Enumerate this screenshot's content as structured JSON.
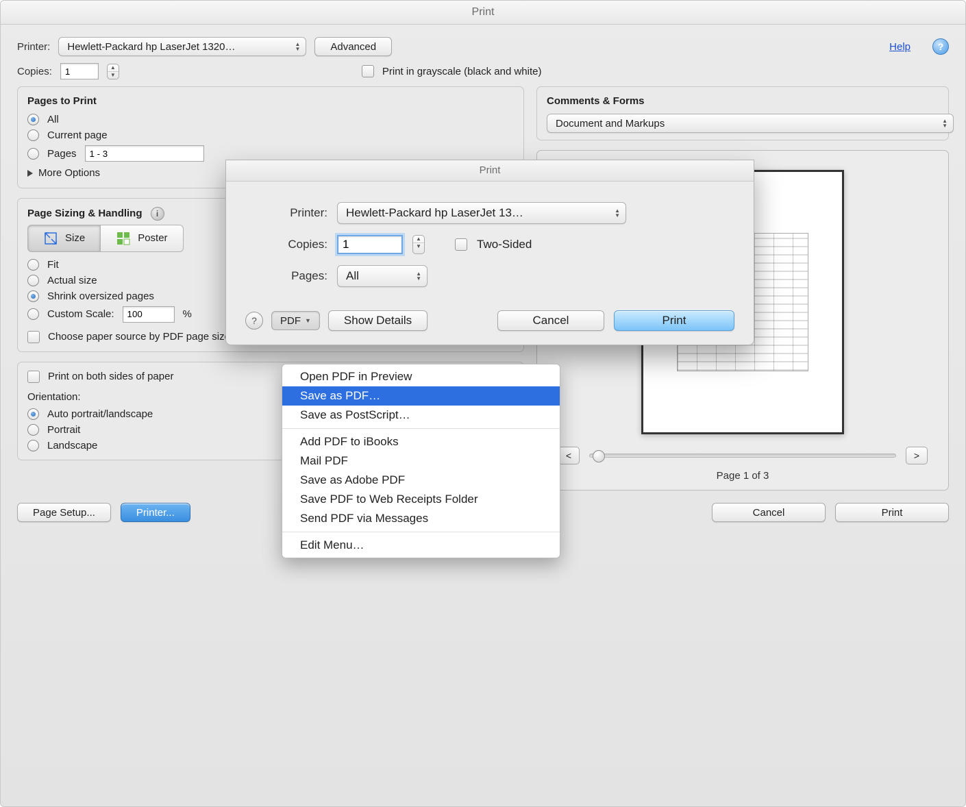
{
  "window": {
    "title": "Print"
  },
  "header": {
    "printer_label": "Printer:",
    "printer_value": "Hewlett-Packard hp LaserJet 1320…",
    "advanced": "Advanced",
    "help": "Help",
    "copies_label": "Copies:",
    "copies_value": "1",
    "grayscale_label": "Print in grayscale (black and white)"
  },
  "pages": {
    "title": "Pages to Print",
    "all": "All",
    "current": "Current page",
    "pages_label": "Pages",
    "pages_value": "1 - 3",
    "more": "More Options"
  },
  "sizing": {
    "title": "Page Sizing & Handling",
    "size_btn": "Size",
    "poster_btn": "Poster",
    "fit": "Fit",
    "actual": "Actual size",
    "shrink": "Shrink oversized pages",
    "custom": "Custom Scale:",
    "custom_value": "100",
    "custom_unit": "%",
    "paper_source": "Choose paper source by PDF page size"
  },
  "orientation": {
    "duplex": "Print on both sides of paper",
    "title": "Orientation:",
    "auto": "Auto portrait/landscape",
    "portrait": "Portrait",
    "landscape": "Landscape"
  },
  "comments": {
    "title": "Comments & Forms",
    "value": "Document and Markups"
  },
  "preview": {
    "prev": "<",
    "next": ">",
    "page_of": "Page 1 of 3"
  },
  "footer": {
    "page_setup": "Page Setup...",
    "printer": "Printer...",
    "cancel": "Cancel",
    "print": "Print"
  },
  "sheet": {
    "title": "Print",
    "printer_label": "Printer:",
    "printer_value": "Hewlett-Packard hp LaserJet 13…",
    "copies_label": "Copies:",
    "copies_value": "1",
    "twosided": "Two-Sided",
    "pages_label": "Pages:",
    "pages_value": "All",
    "pdf_btn": "PDF",
    "show_details": "Show Details",
    "cancel": "Cancel",
    "print": "Print"
  },
  "menu": {
    "open_preview": "Open PDF in Preview",
    "save_pdf": "Save as PDF…",
    "save_ps": "Save as PostScript…",
    "add_ibooks": "Add PDF to iBooks",
    "mail_pdf": "Mail PDF",
    "save_adobe": "Save as Adobe PDF",
    "save_receipts": "Save PDF to Web Receipts Folder",
    "send_messages": "Send PDF via Messages",
    "edit_menu": "Edit Menu…"
  }
}
